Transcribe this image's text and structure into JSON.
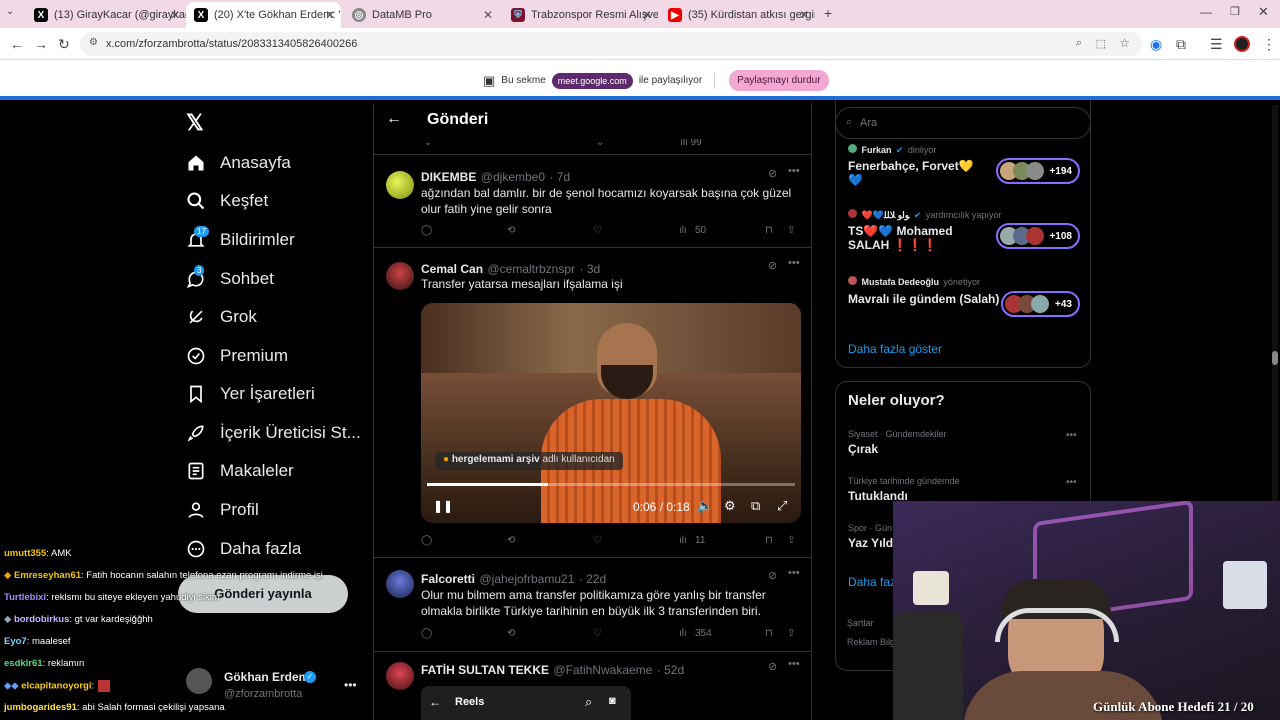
{
  "browser": {
    "tabs": [
      {
        "label": "(13) GirayKacar (@giraykacar) /",
        "icon": "x-logo"
      },
      {
        "label": "(20) X'te Gökhan Erdem: \"Tr",
        "icon": "x-logo"
      },
      {
        "label": "DataMB Pro",
        "icon": "globe-icon"
      },
      {
        "label": "Trabzonspor Resmi Alışveriş Site",
        "icon": "ts-logo"
      },
      {
        "label": "(35) Kürdistan atkısı gerginliği",
        "icon": "youtube-icon"
      }
    ],
    "new_tab": "+",
    "url": "x.com/zforzambrotta/status/2083313405826400266"
  },
  "share_bar": {
    "text_before": "Bu sekme",
    "meet": "meet.google.com",
    "text_after": "ile paylaşılıyor",
    "stop": "Paylaşmayı durdur"
  },
  "nav": {
    "items": [
      {
        "label": "Anasayfa",
        "icon": "home-icon"
      },
      {
        "label": "Keşfet",
        "icon": "search-icon"
      },
      {
        "label": "Bildirimler",
        "icon": "bell-icon",
        "badge": "17"
      },
      {
        "label": "Sohbet",
        "icon": "chat-icon",
        "badge": "3"
      },
      {
        "label": "Grok",
        "icon": "grok-icon"
      },
      {
        "label": "Premium",
        "icon": "premium-icon"
      },
      {
        "label": "Yer İşaretleri",
        "icon": "bookmark-icon"
      },
      {
        "label": "İçerik Üreticisi St...",
        "icon": "rocket-icon"
      },
      {
        "label": "Makaleler",
        "icon": "articles-icon"
      },
      {
        "label": "Profil",
        "icon": "person-icon"
      },
      {
        "label": "Daha fazla",
        "icon": "more-circle-icon"
      }
    ],
    "post_button": "Gönderi yayınla",
    "account": {
      "name": "Gökhan Erdem",
      "handle": "@zforzambrotta"
    }
  },
  "header": {
    "title": "Gönderi"
  },
  "posts": [
    {
      "name": "DIKEMBE",
      "handle": "@djkembe0",
      "time": "· 7d",
      "text": "ağzından bal damlır. bir de şenol hocamızı koyarsak başına çok güzel olur fatih yine gelir sonra",
      "views": "50"
    },
    {
      "name": "Cemal Can",
      "handle": "@cemaltrbznspr",
      "time": "· 3d",
      "text": "Transfer yatarsa mesajları ifşalama işi",
      "views": "11",
      "video": {
        "credit_user": "hergelemami arşiv",
        "credit_suffix": "adlı kullanıcıdan",
        "time": "0:06 / 0:18",
        "progress": 0.33
      }
    },
    {
      "name": "Falcoretti",
      "handle": "@jahejofrbamu21",
      "time": "· 22d",
      "text": "Olur mu bilmem ama transfer politikamıza göre yanlış bir transfer olmakla birlikte Türkiye tarihinin en büyük ilk 3 transferinden biri.",
      "views": "354"
    },
    {
      "name": "FATİH SULTAN TEKKE",
      "handle": "@FatihNwakaeme",
      "time": "· 52d"
    }
  ],
  "reels_bar": {
    "title": "Reels"
  },
  "right": {
    "search_placeholder": "Ara",
    "live": [
      {
        "host": "Furkan",
        "role": "dinliyor",
        "title": "Fenerbahçe, Forvet💛💙",
        "count": "+194"
      },
      {
        "host": "❤️💙ﻮﻟﻭ ﻼﻠﻠ",
        "role": "yardımcılık yapıyor",
        "title": "TS❤️💙 Mohamed SALAH ❗❗❗",
        "count": "+108"
      },
      {
        "host": "Mustafa Dedeoğlu",
        "role": "yönetiyor",
        "title": "Mavralı ile gündem (Salah)",
        "count": "+43"
      }
    ],
    "show_more": "Daha fazla göster",
    "trends_title": "Neler oluyor?",
    "trends": [
      {
        "category": "Siyaset · Gündemdekiler",
        "name": "Çırak"
      },
      {
        "category": "Türkiye tarihinde gündemde",
        "name": "Tutuklandı"
      },
      {
        "category": "Spor · Gün",
        "name": "Yaz Yıldı"
      }
    ],
    "trends_more": "Daha faz",
    "footer": [
      "Şartlar",
      "Reklam Bilgi"
    ]
  },
  "chat": [
    {
      "user": "umutt355",
      "msg": ": AMK",
      "color": "#f1c40f"
    },
    {
      "user": "Emreseyhan61",
      "msg": ": Fatih hocanın salahın telefona ezan programı indirme işi",
      "color": "#f1c40f"
    },
    {
      "user": "Turtlebixi",
      "msg": ": reklsmı bu siteye ekleyen yahudiyi sikim",
      "color": "#a78bfa"
    },
    {
      "user": "bordobirkus",
      "msg": ": gt var kardeşiğğhh",
      "color": "#c4b5fd"
    },
    {
      "user": "Eyo7",
      "msg": ": maalesef",
      "color": "#7dd3fc"
    },
    {
      "user": "esdklr61",
      "msg": ": reklamın",
      "color": "#4ade80"
    },
    {
      "user": "elcapitanoyorgi",
      "msg": ":",
      "color": "#facc15"
    },
    {
      "user": "jumbogarides91",
      "msg": ": abi Salah formasi çekilişi yapsana",
      "color": "#fde047"
    }
  ],
  "overlay": {
    "goal": "Günlük Abone Hedefi 21 / 20"
  }
}
